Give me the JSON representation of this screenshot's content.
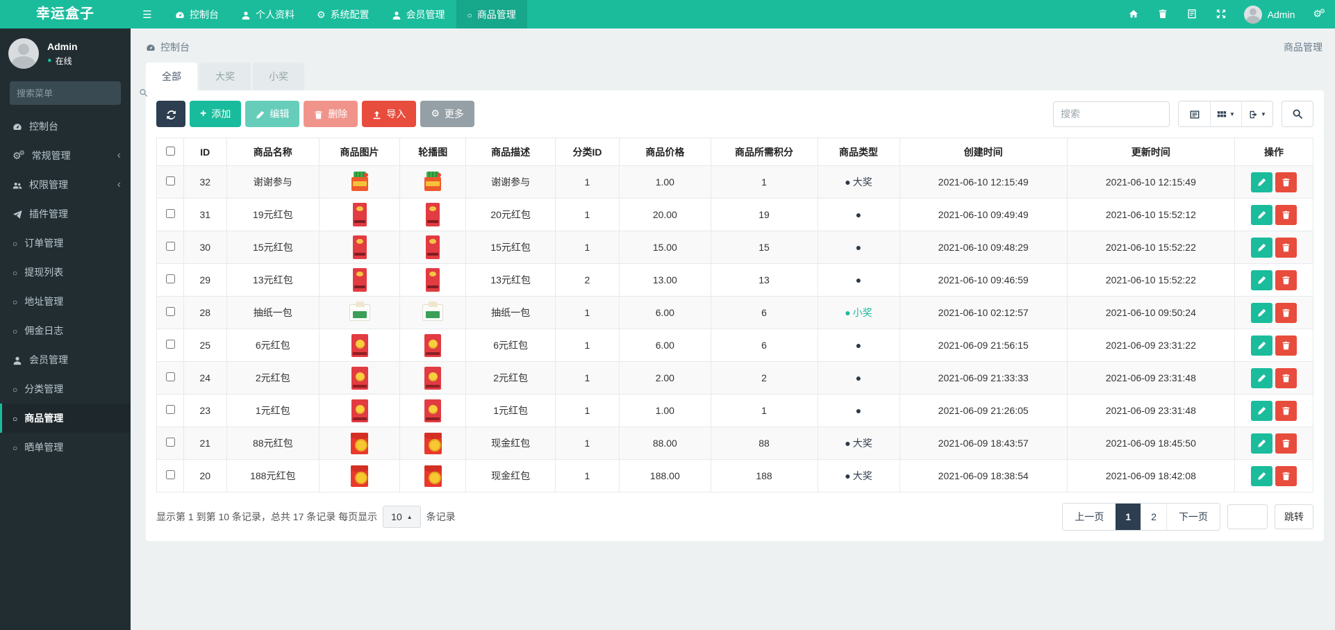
{
  "brand": "幸运盒子",
  "navbar": {
    "menu": [
      {
        "key": "dashboard",
        "label": "控制台",
        "icon": "dashboard-icon",
        "active": false
      },
      {
        "key": "profile",
        "label": "个人资料",
        "icon": "user-icon",
        "active": false
      },
      {
        "key": "system-config",
        "label": "系统配置",
        "icon": "gear-icon",
        "active": false
      },
      {
        "key": "members",
        "label": "会员管理",
        "icon": "user-icon",
        "active": false
      },
      {
        "key": "products",
        "label": "商品管理",
        "icon": "circle-icon",
        "active": true
      }
    ],
    "user_name": "Admin"
  },
  "sidebar": {
    "user_name": "Admin",
    "user_status": "在线",
    "search_placeholder": "搜索菜单",
    "menu": [
      {
        "key": "dashboard",
        "label": "控制台",
        "icon": "dashboard-icon",
        "active": false,
        "arrow": false
      },
      {
        "key": "general",
        "label": "常规管理",
        "icon": "gears-icon",
        "active": false,
        "arrow": true
      },
      {
        "key": "permissions",
        "label": "权限管理",
        "icon": "users-icon",
        "active": false,
        "arrow": true
      },
      {
        "key": "plugins",
        "label": "插件管理",
        "icon": "plugin-icon",
        "active": false,
        "arrow": false
      },
      {
        "key": "orders",
        "label": "订单管理",
        "icon": "circle-icon",
        "active": false,
        "arrow": false
      },
      {
        "key": "withdrawals",
        "label": "提现列表",
        "icon": "circle-icon",
        "active": false,
        "arrow": false
      },
      {
        "key": "addresses",
        "label": "地址管理",
        "icon": "circle-icon",
        "active": false,
        "arrow": false
      },
      {
        "key": "commission-log",
        "label": "佣金日志",
        "icon": "circle-icon",
        "active": false,
        "arrow": false
      },
      {
        "key": "members",
        "label": "会员管理",
        "icon": "user-icon",
        "active": false,
        "arrow": false
      },
      {
        "key": "categories",
        "label": "分类管理",
        "icon": "circle-icon",
        "active": false,
        "arrow": false
      },
      {
        "key": "products",
        "label": "商品管理",
        "icon": "circle-icon",
        "active": true,
        "arrow": false
      },
      {
        "key": "reviews",
        "label": "晒单管理",
        "icon": "circle-icon",
        "active": false,
        "arrow": false
      }
    ]
  },
  "breadcrumb": {
    "location": "控制台",
    "page": "商品管理"
  },
  "tabs": [
    {
      "label": "全部",
      "active": true
    },
    {
      "label": "大奖",
      "active": false
    },
    {
      "label": "小奖",
      "active": false
    }
  ],
  "toolbar": {
    "add": "添加",
    "edit": "编辑",
    "delete": "删除",
    "import": "导入",
    "more": "更多",
    "search_placeholder": "搜索"
  },
  "table": {
    "columns": [
      "ID",
      "商品名称",
      "商品图片",
      "轮播图",
      "商品描述",
      "分类ID",
      "商品价格",
      "商品所需积分",
      "商品类型",
      "创建时间",
      "更新时间",
      "操作"
    ],
    "rows": [
      {
        "id": "32",
        "name": "谢谢参与",
        "image": "gift-box",
        "desc": "谢谢参与",
        "category_id": "1",
        "price": "1.00",
        "points": "1",
        "type": "大奖",
        "type_color": "dark",
        "created": "2021-06-10 12:15:49",
        "updated": "2021-06-10 12:15:49"
      },
      {
        "id": "31",
        "name": "19元红包",
        "image": "red-packet",
        "desc": "20元红包",
        "category_id": "1",
        "price": "20.00",
        "points": "19",
        "type": "",
        "type_color": "dark",
        "created": "2021-06-10 09:49:49",
        "updated": "2021-06-10 15:52:12"
      },
      {
        "id": "30",
        "name": "15元红包",
        "image": "red-packet",
        "desc": "15元红包",
        "category_id": "1",
        "price": "15.00",
        "points": "15",
        "type": "",
        "type_color": "dark",
        "created": "2021-06-10 09:48:29",
        "updated": "2021-06-10 15:52:22"
      },
      {
        "id": "29",
        "name": "13元红包",
        "image": "red-packet",
        "desc": "13元红包",
        "category_id": "2",
        "price": "13.00",
        "points": "13",
        "type": "",
        "type_color": "dark",
        "created": "2021-06-10 09:46:59",
        "updated": "2021-06-10 15:52:22"
      },
      {
        "id": "28",
        "name": "抽纸一包",
        "image": "tissue",
        "desc": "抽纸一包",
        "category_id": "1",
        "price": "6.00",
        "points": "6",
        "type": "小奖",
        "type_color": "teal",
        "created": "2021-06-10 02:12:57",
        "updated": "2021-06-10 09:50:24"
      },
      {
        "id": "25",
        "name": "6元红包",
        "image": "red-packet-gold",
        "desc": "6元红包",
        "category_id": "1",
        "price": "6.00",
        "points": "6",
        "type": "",
        "type_color": "dark",
        "created": "2021-06-09 21:56:15",
        "updated": "2021-06-09 23:31:22"
      },
      {
        "id": "24",
        "name": "2元红包",
        "image": "red-packet-gold",
        "desc": "2元红包",
        "category_id": "1",
        "price": "2.00",
        "points": "2",
        "type": "",
        "type_color": "dark",
        "created": "2021-06-09 21:33:33",
        "updated": "2021-06-09 23:31:48"
      },
      {
        "id": "23",
        "name": "1元红包",
        "image": "red-packet-gold",
        "desc": "1元红包",
        "category_id": "1",
        "price": "1.00",
        "points": "1",
        "type": "",
        "type_color": "dark",
        "created": "2021-06-09 21:26:05",
        "updated": "2021-06-09 23:31:48"
      },
      {
        "id": "21",
        "name": "88元红包",
        "image": "red-packet-coin",
        "desc": "现金红包",
        "category_id": "1",
        "price": "88.00",
        "points": "88",
        "type": "大奖",
        "type_color": "dark",
        "created": "2021-06-09 18:43:57",
        "updated": "2021-06-09 18:45:50"
      },
      {
        "id": "20",
        "name": "188元红包",
        "image": "red-packet-coin",
        "desc": "现金红包",
        "category_id": "1",
        "price": "188.00",
        "points": "188",
        "type": "大奖",
        "type_color": "dark",
        "created": "2021-06-09 18:38:54",
        "updated": "2021-06-09 18:42:08"
      }
    ]
  },
  "pagination": {
    "summary_prefix": "显示第 1 到第 10 条记录，总共 17 条记录 每页显示",
    "page_size": "10",
    "summary_suffix": "条记录",
    "prev": "上一页",
    "pages": [
      {
        "label": "1",
        "active": true
      },
      {
        "label": "2",
        "active": false
      }
    ],
    "next": "下一页",
    "jump": "跳转"
  },
  "colors": {
    "accent": "#1abc9c",
    "dark": "#2c3e50",
    "danger": "#e74c3c",
    "sidebar_bg": "#222d32",
    "page_bg": "#eef1f2"
  }
}
